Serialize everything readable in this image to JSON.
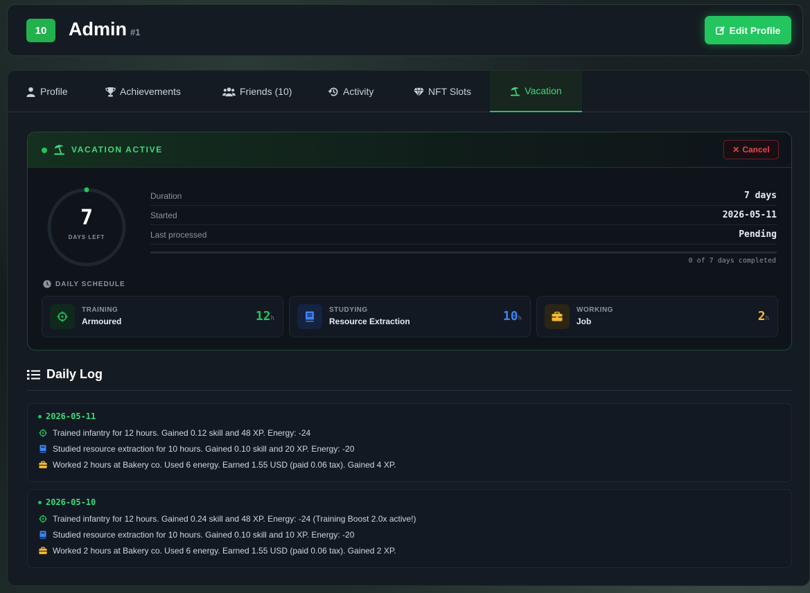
{
  "header": {
    "level": "10",
    "name": "Admin",
    "user_id": "#1",
    "edit_label": "Edit Profile"
  },
  "tabs": [
    {
      "label": "Profile",
      "icon": "user-icon"
    },
    {
      "label": "Achievements",
      "icon": "trophy-icon"
    },
    {
      "label": "Friends (10)",
      "icon": "users-icon"
    },
    {
      "label": "Activity",
      "icon": "history-icon"
    },
    {
      "label": "NFT Slots",
      "icon": "gem-icon"
    },
    {
      "label": "Vacation",
      "icon": "umbrella-beach-icon",
      "active": true
    }
  ],
  "vacation": {
    "status": "VACATION ACTIVE",
    "cancel_label": "Cancel",
    "days_left": "7",
    "days_left_label": "DAYS LEFT",
    "stats": [
      {
        "label": "Duration",
        "value": "7 days"
      },
      {
        "label": "Started",
        "value": "2026-05-11"
      },
      {
        "label": "Last processed",
        "value": "Pending"
      }
    ],
    "progress": 0,
    "progress_text": "0 of 7 days completed",
    "schedule_title": "DAILY SCHEDULE",
    "schedule": [
      {
        "kind": "TRAINING",
        "name": "Armoured",
        "hours": "12",
        "unit": "h",
        "color": "#22c55e",
        "icon": "crosshairs-icon"
      },
      {
        "kind": "STUDYING",
        "name": "Resource Extraction",
        "hours": "10",
        "unit": "h",
        "color": "#3b82f6",
        "icon": "book-icon"
      },
      {
        "kind": "WORKING",
        "name": "Job",
        "hours": "2",
        "unit": "h",
        "color": "#f5b82e",
        "icon": "briefcase-icon"
      }
    ]
  },
  "log": {
    "title": "Daily Log",
    "days": [
      {
        "date": "2026-05-11",
        "entries": [
          {
            "icon": "crosshairs-icon",
            "text": "Trained infantry for 12 hours. Gained 0.12 skill and 48 XP. Energy: -24"
          },
          {
            "icon": "book-icon",
            "text": "Studied resource extraction for 10 hours. Gained 0.10 skill and 20 XP. Energy: -20"
          },
          {
            "icon": "briefcase-icon",
            "text": "Worked 2 hours at Bakery co. Used 6 energy. Earned 1.55 USD (paid 0.06 tax). Gained 4 XP."
          }
        ]
      },
      {
        "date": "2026-05-10",
        "entries": [
          {
            "icon": "crosshairs-icon",
            "text": "Trained infantry for 12 hours. Gained 0.24 skill and 48 XP. Energy: -24 (Training Boost 2.0x active!)"
          },
          {
            "icon": "book-icon",
            "text": "Studied resource extraction for 10 hours. Gained 0.10 skill and 10 XP. Energy: -20"
          },
          {
            "icon": "briefcase-icon",
            "text": "Worked 2 hours at Bakery co. Used 6 energy. Earned 1.55 USD (paid 0.06 tax). Gained 2 XP."
          }
        ]
      }
    ]
  },
  "colors": {
    "accent": "#22c55e",
    "danger": "#ef4444",
    "study": "#3b82f6",
    "work": "#f5b82e"
  }
}
